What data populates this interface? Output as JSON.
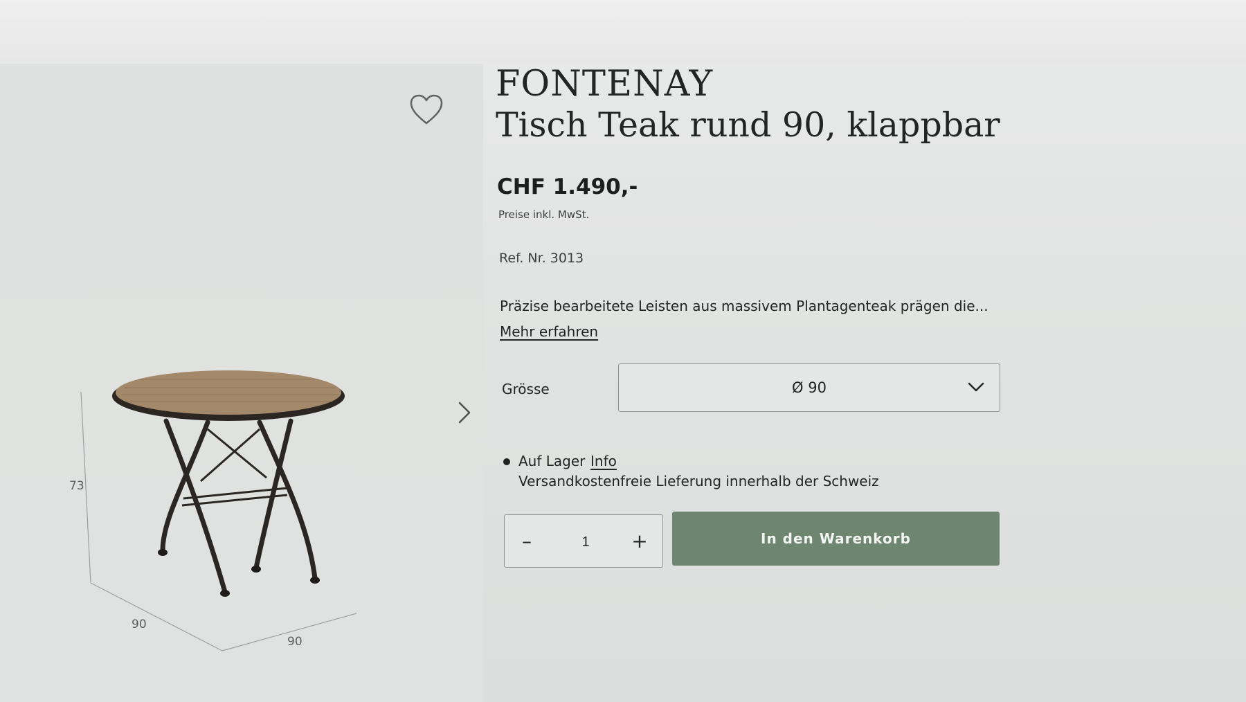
{
  "product": {
    "brand": "FONTENAY",
    "title": "Tisch Teak rund 90, klappbar",
    "price": "CHF 1.490,-",
    "price_note": "Preise inkl. MwSt.",
    "ref": "Ref. Nr. 3013",
    "description": "Präzise bearbeitete Leisten aus massivem Plantagenteak prägen die...",
    "more_link": "Mehr erfahren"
  },
  "image": {
    "dimensions": {
      "height": "73",
      "depth": "90",
      "width": "90"
    },
    "wishlist_icon": "heart-icon",
    "next_icon": "chevron-right-icon"
  },
  "size": {
    "label": "Grösse",
    "selected": "Ø 90",
    "icon": "chevron-down-icon"
  },
  "stock": {
    "status": "Auf Lager",
    "info_link": "Info",
    "shipping": "Versandkostenfreie Lieferung innerhalb der Schweiz"
  },
  "cart": {
    "minus": "–",
    "quantity": "1",
    "plus": "+",
    "button_label": "In den Warenkorb"
  },
  "colors": {
    "accent": "#6e8570",
    "text": "#232524",
    "background": "#e2e4e3"
  }
}
